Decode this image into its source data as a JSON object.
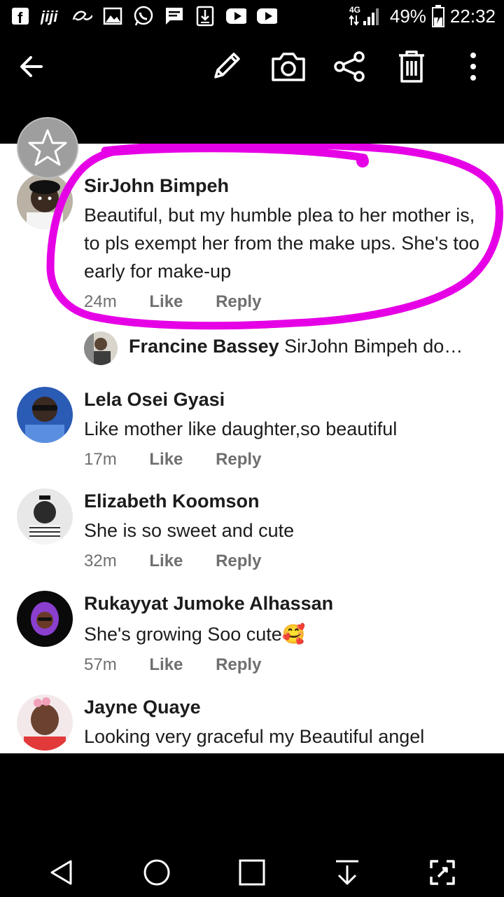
{
  "status_bar": {
    "network": "4G",
    "battery": "49%",
    "battery_level": 0.49,
    "time": "22:32",
    "notification_icons": [
      "facebook-icon",
      "jiji-icon",
      "alibaba-icon",
      "image-icon",
      "whatsapp-icon",
      "message-icon",
      "download-icon",
      "youtube-icon",
      "youtube-icon"
    ]
  },
  "toolbar": {
    "icons": [
      "back-arrow-icon",
      "edit-pencil-icon",
      "camera-icon",
      "share-icon",
      "delete-trash-icon",
      "more-vertical-icon"
    ]
  },
  "colors": {
    "highlight": "#e600e6",
    "text": "#1c1c1c",
    "meta": "#6f6f6f"
  },
  "comments": [
    {
      "author": "SirJohn Bimpeh",
      "text": "Beautiful, but my humble plea to her mother is, to pls exempt her from the make ups. She's too early for make-up",
      "time": "24m",
      "like": "Like",
      "reply": "Reply"
    },
    {
      "author": "Lela Osei Gyasi",
      "text": "Like mother  like daughter,so beautiful",
      "time": "17m",
      "like": "Like",
      "reply": "Reply"
    },
    {
      "author": "Elizabeth Koomson",
      "text": "She is so sweet and cute",
      "time": "32m",
      "like": "Like",
      "reply": "Reply"
    },
    {
      "author": "Rukayyat Jumoke Alhassan",
      "text": "She's growing Soo cute🥰",
      "time": "57m",
      "like": "Like",
      "reply": "Reply"
    },
    {
      "author": "Jayne Quaye",
      "text": "Looking very graceful my Beautiful angel"
    }
  ],
  "reply_preview": {
    "author": "Francine Bassey",
    "text": "SirJohn Bimpeh do…"
  },
  "nav_bar": {
    "icons": [
      "back-triangle-icon",
      "home-circle-icon",
      "recents-square-icon",
      "download-arrow-icon",
      "screenshot-expand-icon"
    ]
  }
}
